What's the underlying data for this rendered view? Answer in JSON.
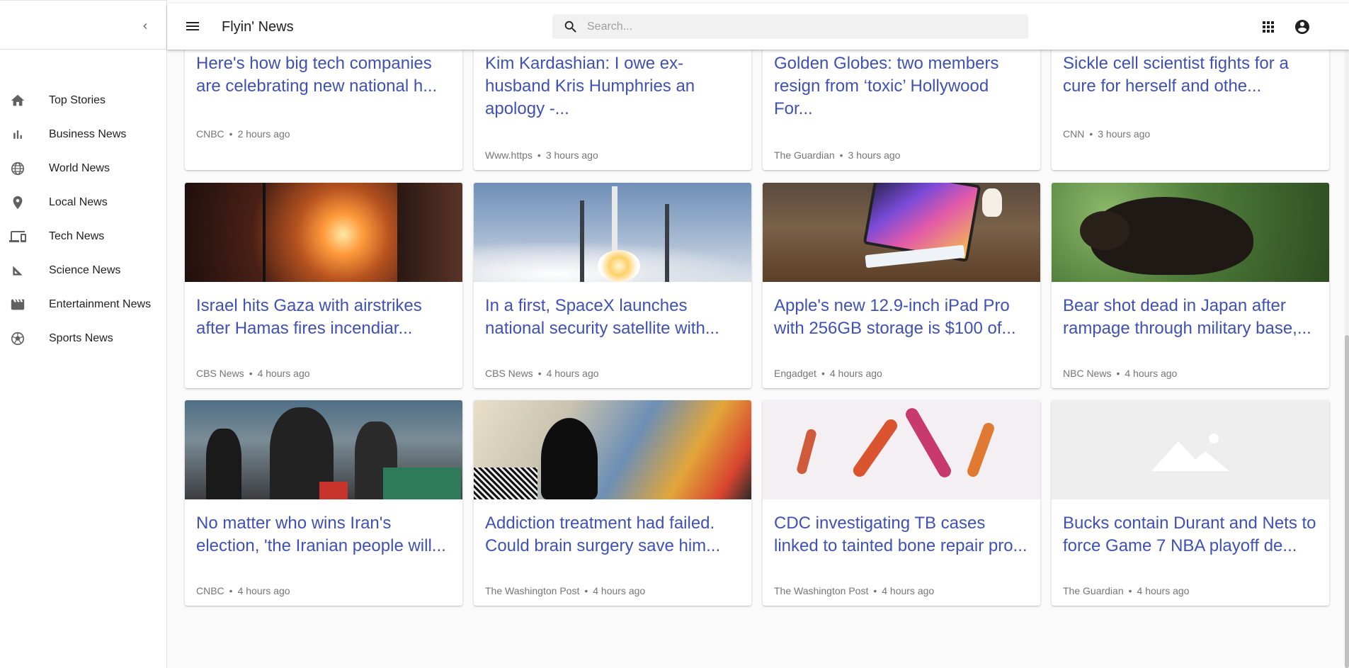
{
  "app": {
    "title": "Flyin' News"
  },
  "search": {
    "placeholder": "Search..."
  },
  "sidebar": {
    "items": [
      {
        "label": "Top Stories",
        "icon": "home-icon"
      },
      {
        "label": "Business News",
        "icon": "bar-chart-icon"
      },
      {
        "label": "World News",
        "icon": "globe-icon"
      },
      {
        "label": "Local News",
        "icon": "location-pin-icon"
      },
      {
        "label": "Tech News",
        "icon": "devices-icon"
      },
      {
        "label": "Science News",
        "icon": "ruler-icon"
      },
      {
        "label": "Entertainment News",
        "icon": "movie-icon"
      },
      {
        "label": "Sports News",
        "icon": "soccer-ball-icon"
      }
    ]
  },
  "cards": [
    {
      "title": "Here's how big tech companies are celebrating new national h...",
      "source": "CNBC",
      "time": "2 hours ago"
    },
    {
      "title": "Kim Kardashian: I owe ex-husband Kris Humphries an apology -...",
      "source": "Www.https",
      "time": "3 hours ago"
    },
    {
      "title": "Golden Globes: two members resign from ‘toxic’ Hollywood For...",
      "source": "The Guardian",
      "time": "3 hours ago"
    },
    {
      "title": "Sickle cell scientist fights for a cure for herself and othe...",
      "source": "CNN",
      "time": "3 hours ago"
    },
    {
      "title": "Israel hits Gaza with airstrikes after Hamas fires incendiar...",
      "source": "CBS News",
      "time": "4 hours ago",
      "image": "night-explosion-photo"
    },
    {
      "title": "In a first, SpaceX launches national security satellite with...",
      "source": "CBS News",
      "time": "4 hours ago",
      "image": "rocket-launch-photo"
    },
    {
      "title": "Apple's new 12.9-inch iPad Pro with 256GB storage is $100 of...",
      "source": "Engadget",
      "time": "4 hours ago",
      "image": "ipad-photo"
    },
    {
      "title": "Bear shot dead in Japan after rampage through military base,...",
      "source": "NBC News",
      "time": "4 hours ago",
      "image": "bear-photo"
    },
    {
      "title": "No matter who wins Iran's election, 'the Iranian people will...",
      "source": "CNBC",
      "time": "4 hours ago",
      "image": "voting-photo"
    },
    {
      "title": "Addiction treatment had failed. Could brain surgery save him...",
      "source": "The Washington Post",
      "time": "4 hours ago",
      "image": "brain-art-photo"
    },
    {
      "title": "CDC investigating TB cases linked to tainted bone repair pro...",
      "source": "The Washington Post",
      "time": "4 hours ago",
      "image": "bacteria-photo"
    },
    {
      "title": "Bucks contain Durant and Nets to force Game 7 NBA playoff de...",
      "source": "The Guardian",
      "time": "4 hours ago",
      "image": "placeholder-image"
    }
  ],
  "colors": {
    "link": "#3f51b5",
    "meta": "#757575",
    "icon": "#616161"
  }
}
